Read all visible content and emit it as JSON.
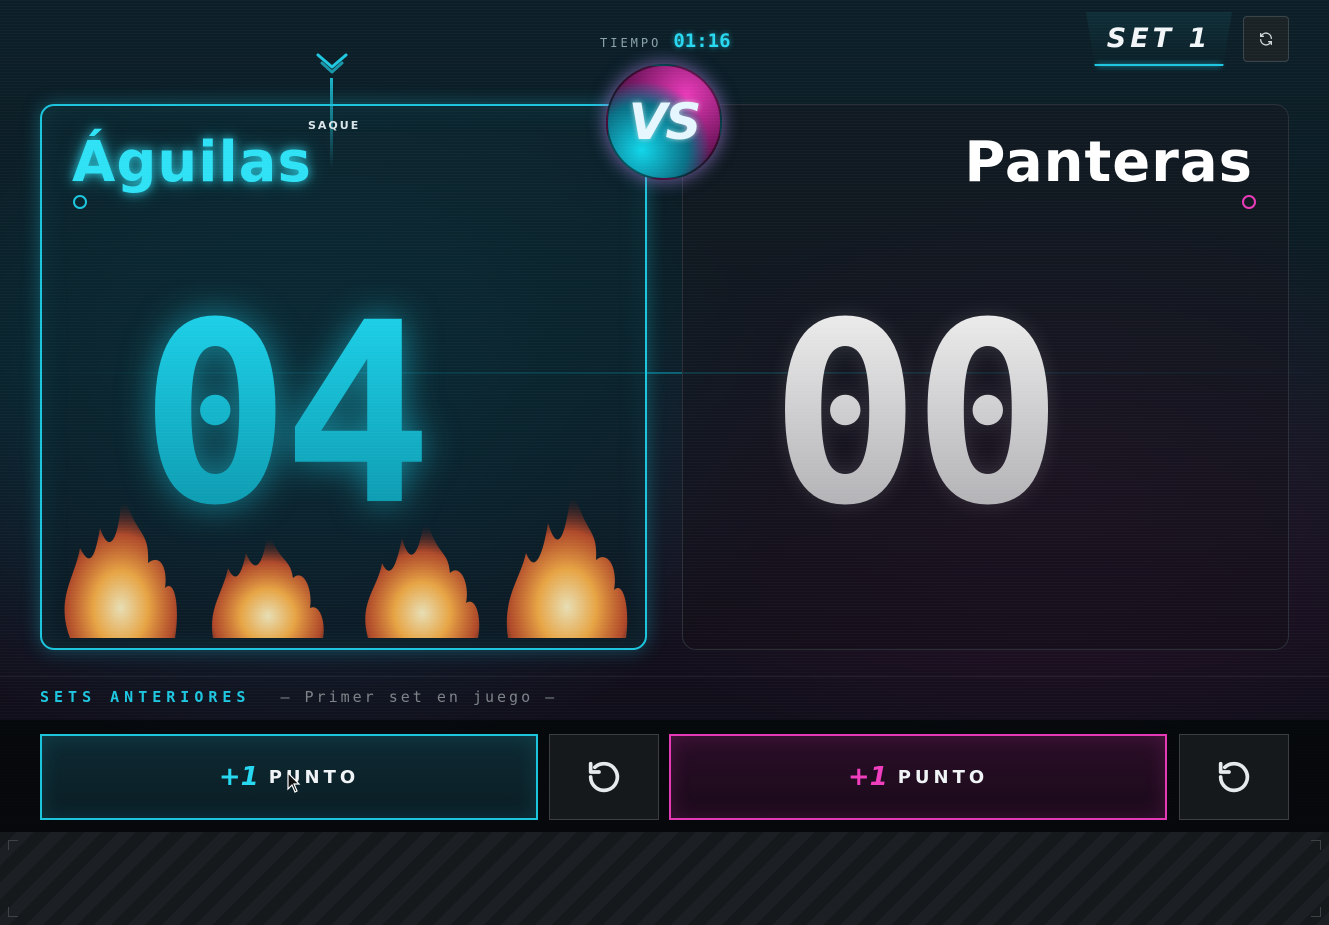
{
  "header": {
    "timer_label": "TIEMPO",
    "timer_value": "01:16",
    "set_label": "SET 1",
    "reset_icon": "refresh-icon"
  },
  "teams": {
    "left": {
      "name": "Águilas",
      "score": "04",
      "serving": true,
      "accent": "#1cc4dc"
    },
    "right": {
      "name": "Panteras",
      "score": "00",
      "serving": false,
      "accent": "#e43ab6"
    }
  },
  "serve": {
    "label": "SAQUE"
  },
  "vs": {
    "label": "VS"
  },
  "sets": {
    "label": "SETS ANTERIORES",
    "empty_text": "— Primer set en juego —"
  },
  "controls": {
    "left_plus": "+1",
    "left_text": "PUNTO",
    "right_plus": "+1",
    "right_text": "PUNTO",
    "undo_icon": "undo-icon"
  }
}
